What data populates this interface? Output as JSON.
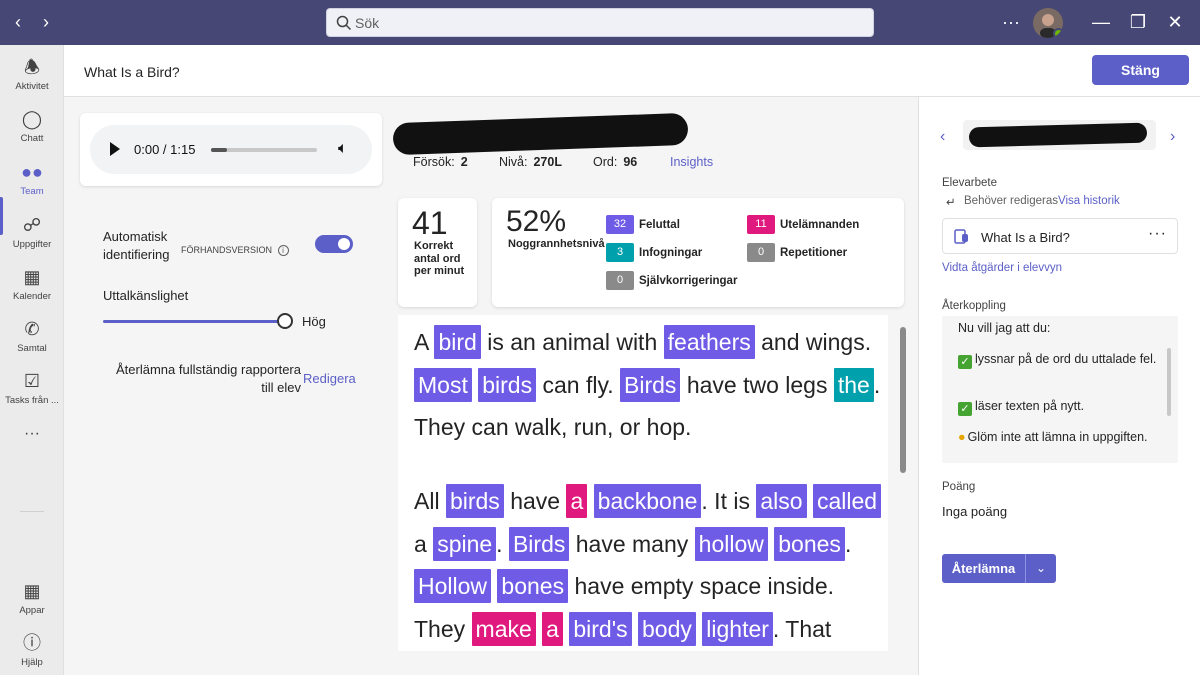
{
  "search": {
    "placeholder": "Sök"
  },
  "rail": {
    "items": [
      {
        "label": "Aktivitet",
        "icon": "bell-icon"
      },
      {
        "label": "Chatt",
        "icon": "chat-icon"
      },
      {
        "label": "Team",
        "icon": "teams-icon"
      },
      {
        "label": "Uppgifter",
        "icon": "assignments-icon"
      },
      {
        "label": "Kalender",
        "icon": "calendar-icon"
      },
      {
        "label": "Samtal",
        "icon": "phone-icon"
      },
      {
        "label": "Tasks från ...",
        "icon": "tasks-icon"
      },
      {
        "label": "Appar",
        "icon": "apps-icon"
      },
      {
        "label": "Hjälp",
        "icon": "help-icon"
      }
    ],
    "more": "···"
  },
  "header": {
    "title": "What Is a Bird?",
    "close_label": "Stäng"
  },
  "audio": {
    "time": "0:00 / 1:15",
    "progress": 0.15
  },
  "options": {
    "auto_id_label": "Automatisk identifiering",
    "preview_tag": "FÖRHANDSVERSION",
    "pronunciation_label": "Uttalkänslighet",
    "sensitivity_value": "Hög",
    "return_report_label": "Återlämna fullständig rapportera till elev",
    "edit_link": "Redigera"
  },
  "stats": {
    "attempts_label": "Försök:",
    "attempts": "2",
    "level_label": "Nivå:",
    "level": "270L",
    "words_label": "Ord:",
    "words": "96",
    "insights": "Insights"
  },
  "wcpm": {
    "value": "41",
    "label": "Korrekt antal ord per minut"
  },
  "accuracy": {
    "value": "52%",
    "label": "Noggrannhetsnivå"
  },
  "errors": [
    {
      "count": "32",
      "label": "Feluttal",
      "color": "#6e5ce6"
    },
    {
      "count": "11",
      "label": "Utelämnanden",
      "color": "#e0197f"
    },
    {
      "count": "3",
      "label": "Infogningar",
      "color": "#00a0ad"
    },
    {
      "count": "0",
      "label": "Repetitioner",
      "color": "#8a8a8a"
    },
    {
      "count": "0",
      "label": "Självkorrigeringar",
      "color": "#8a8a8a"
    }
  ],
  "passage": {
    "p1": [
      [
        "A",
        ""
      ],
      [
        "bird",
        "m"
      ],
      [
        "is an animal with",
        ""
      ],
      [
        "feathers",
        "m"
      ],
      [
        "and wings.",
        ""
      ],
      [
        "Most",
        "m"
      ],
      [
        "birds",
        "m"
      ],
      [
        "can fly.",
        ""
      ],
      [
        "Birds",
        "m"
      ],
      [
        "have two legs",
        ""
      ],
      [
        "the",
        "i"
      ],
      [
        ".",
        ""
      ],
      [
        "They can walk, run, or hop.",
        ""
      ]
    ],
    "p2": [
      [
        "All",
        ""
      ],
      [
        "birds",
        "m"
      ],
      [
        "have",
        ""
      ],
      [
        "a",
        "o"
      ],
      [
        "backbone",
        "m"
      ],
      [
        ". It is",
        ""
      ],
      [
        "also",
        "m"
      ],
      [
        "called",
        "m"
      ],
      [
        "a",
        ""
      ],
      [
        "spine",
        "m"
      ],
      [
        ".",
        ""
      ],
      [
        "Birds",
        "m"
      ],
      [
        "have many",
        ""
      ],
      [
        "hollow",
        "m"
      ],
      [
        "bones",
        "m"
      ],
      [
        ".",
        ""
      ],
      [
        "Hollow",
        "m"
      ],
      [
        "bones",
        "m"
      ],
      [
        "have empty space inside.",
        ""
      ],
      [
        "They",
        ""
      ],
      [
        "make",
        "o"
      ],
      [
        "a",
        "o"
      ],
      [
        "bird's",
        "m"
      ],
      [
        "body",
        "m"
      ],
      [
        "lighter",
        "m"
      ],
      [
        ". That",
        ""
      ]
    ]
  },
  "right": {
    "section_label": "Elevarbete",
    "status": "Behöver redigeras",
    "history_link": "Visa historik",
    "assignment_title": "What Is a Bird?",
    "more": "···",
    "actions_link": "Vidta åtgärder i elevvyn",
    "feedback_label": "Återkoppling",
    "feedback_lines": [
      "Nu vill jag att du:",
      "lyssnar på de ord du uttalade fel.",
      "läser texten på nytt.",
      "Glöm inte att lämna in uppgiften."
    ],
    "points_label": "Poäng",
    "points_value": "Inga poäng",
    "return_button": "Återlämna"
  }
}
